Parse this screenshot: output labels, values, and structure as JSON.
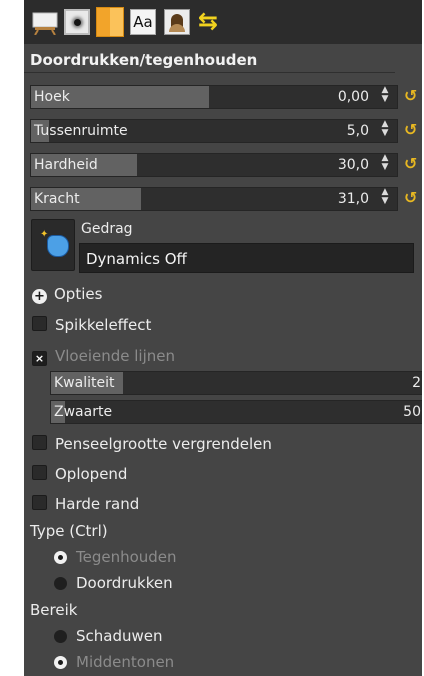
{
  "tabs": [
    {
      "name": "paint-tool-icon"
    },
    {
      "name": "brush-icon"
    },
    {
      "name": "pattern-icon"
    },
    {
      "name": "font-icon",
      "label": "Aa"
    },
    {
      "name": "image-icon"
    },
    {
      "name": "undo-history-icon",
      "glyph": "⇆"
    }
  ],
  "panel": {
    "title": "Doordrukken/tegenhouden"
  },
  "sliders": {
    "hoek": {
      "label": "Hoek",
      "value": "0,00",
      "fraction": 0.5
    },
    "tussenruimte": {
      "label": "Tussenruimte",
      "value": "5,0",
      "fraction": 0.05
    },
    "hardheid": {
      "label": "Hardheid",
      "value": "30,0",
      "fraction": 0.3
    },
    "kracht": {
      "label": "Kracht",
      "value": "31,0",
      "fraction": 0.31
    }
  },
  "reset_glyph": "↺",
  "dynamics": {
    "label": "Gedrag",
    "value": "Dynamics Off"
  },
  "options": {
    "expander": "Opties",
    "spikkeleffect": "Spikkeleffect",
    "vloeiende_lijnen": "Vloeiende lijnen",
    "kwaliteit": {
      "label": "Kwaliteit",
      "value": "2"
    },
    "zwaarte": {
      "label": "Zwaarte",
      "value": "50"
    },
    "penseelgrootte": "Penseelgrootte vergrendelen",
    "oplopend": "Oplopend",
    "harde_rand": "Harde rand",
    "check_mark": "×"
  },
  "type": {
    "heading": "Type (Ctrl)",
    "items": [
      "Tegenhouden",
      "Doordrukken"
    ],
    "selected": "Tegenhouden"
  },
  "bereik": {
    "heading": "Bereik",
    "items": [
      "Schaduwen",
      "Middentonen"
    ],
    "selected": "Middentonen"
  },
  "colors": {
    "panel_bg": "#454545",
    "tab_strip": "#2c2c2c",
    "reset_accent": "#e7b722"
  }
}
